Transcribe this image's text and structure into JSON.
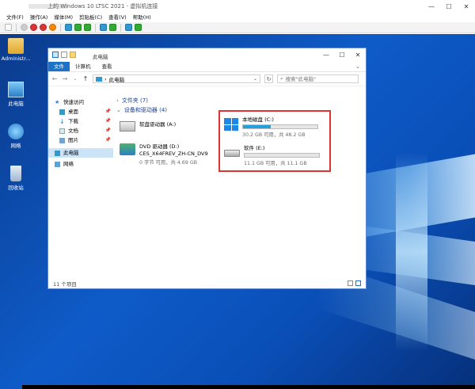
{
  "vm_window": {
    "title": "上的 Windows 10 LTSC 2021 - 虚拟机连接",
    "menu": [
      "文件(F)",
      "操作(A)",
      "媒体(M)",
      "剪贴板(C)",
      "查看(V)",
      "帮助(H)"
    ],
    "controls": [
      "—",
      "☐",
      "✕"
    ]
  },
  "desktop_icons": [
    {
      "label": "Administr..."
    },
    {
      "label": "此电脑"
    },
    {
      "label": "网络"
    },
    {
      "label": "回收站"
    }
  ],
  "explorer": {
    "title": "此电脑",
    "controls": [
      "—",
      "☐",
      "✕"
    ],
    "ribbon_tabs": [
      "文件",
      "计算机",
      "查看"
    ],
    "address": {
      "path": "此电脑",
      "separator": "›"
    },
    "search_placeholder": "搜索\"此电脑\"",
    "nav": {
      "quick_access": "快速访问",
      "items": [
        "桌面",
        "下载",
        "文档",
        "图片"
      ],
      "this_pc": "此电脑",
      "network": "网络"
    },
    "groups": {
      "folders": "文件夹 (7)",
      "devices": "设备和驱动器 (4)"
    },
    "drives": [
      {
        "name": "软盘驱动器 (A:)"
      },
      {
        "name": "DVD 驱动器 (D:)",
        "volume": "CES_X64FREV_ZH-CN_DV9",
        "free": "0 字节 可用，共 4.69 GB"
      },
      {
        "name": "本地磁盘 (C:)",
        "free": "30.2 GB 可用，共 48.2 GB",
        "used_fraction": 0.37,
        "bar_color": "#26a0da"
      },
      {
        "name": "软件 (E:)",
        "free": "11.1 GB 可用，共 11.1 GB",
        "used_fraction": 0.0,
        "bar_color": "#26a0da"
      }
    ],
    "status": "11 个项目"
  }
}
